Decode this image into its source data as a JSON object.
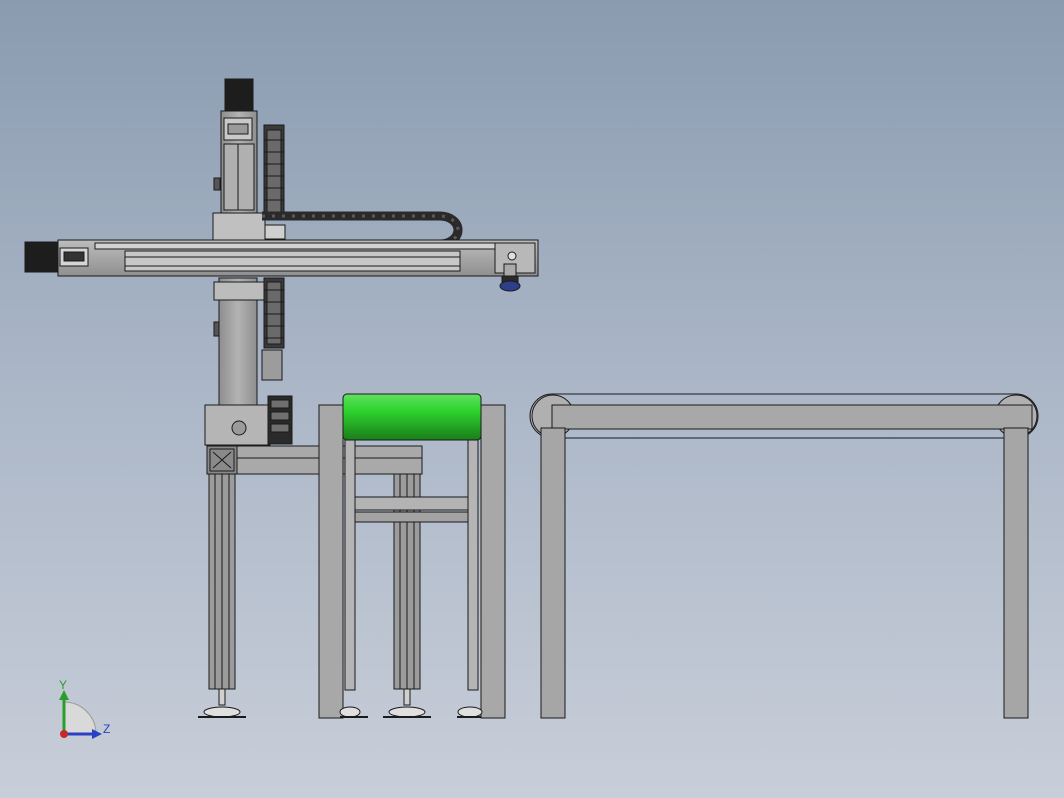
{
  "viewport": {
    "background_top": "#8a9bb0",
    "background_bottom": "#c8ced9"
  },
  "model": {
    "frame_color": "#a6a6a6",
    "dark_color": "#2a2a2a",
    "roller_color": "#2fd52f",
    "edge_color": "#1a1a1a"
  },
  "triad": {
    "y_label": "Y",
    "z_label": "Z",
    "y_color": "#2a9d2a",
    "z_color": "#2a3fc4",
    "x_color": "#c42a2a"
  }
}
